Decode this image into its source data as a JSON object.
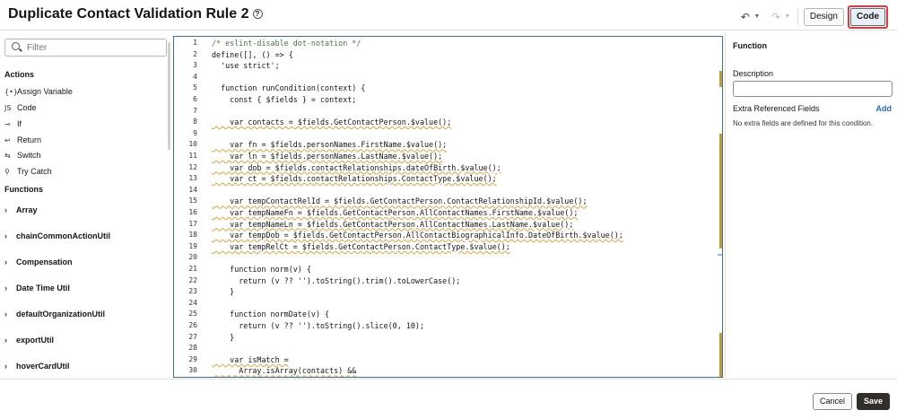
{
  "header": {
    "title": "Duplicate Contact Validation Rule 2",
    "help_glyph": "?",
    "undo_glyph": "↶",
    "redo_glyph": "↷",
    "design_label": "Design",
    "code_label": "Code"
  },
  "left": {
    "search_placeholder": "Filter",
    "actions_heading": "Actions",
    "actions": [
      {
        "icon": "{•}",
        "label": "Assign Variable"
      },
      {
        "icon": "JS",
        "label": "Code"
      },
      {
        "icon": "⊸",
        "label": "If"
      },
      {
        "icon": "↩",
        "label": "Return"
      },
      {
        "icon": "⇆",
        "label": "Switch"
      },
      {
        "icon": "⚲",
        "label": "Try Catch"
      }
    ],
    "functions_heading": "Functions",
    "functions": [
      "Array",
      "chainCommonActionUtil",
      "Compensation",
      "Date Time Util",
      "defaultOrganizationUtil",
      "exportUtil",
      "hoverCardUtil"
    ]
  },
  "editor": {
    "lines": [
      {
        "n": "1",
        "text": "/* eslint-disable dot-notation */"
      },
      {
        "n": "2",
        "text": "define([], () => {"
      },
      {
        "n": "3",
        "text": "  'use strict';"
      },
      {
        "n": "4",
        "text": ""
      },
      {
        "n": "5",
        "text": "  function runCondition(context) {"
      },
      {
        "n": "6",
        "text": "    const { $fields } = context;"
      },
      {
        "n": "7",
        "text": ""
      },
      {
        "n": "8",
        "text": "    var contacts = $fields.GetContactPerson.$value();"
      },
      {
        "n": "9",
        "text": ""
      },
      {
        "n": "10",
        "text": "    var fn = $fields.personNames.FirstName.$value();"
      },
      {
        "n": "11",
        "text": "    var ln = $fields.personNames.LastName.$value();"
      },
      {
        "n": "12",
        "text": "    var dob = $fields.contactRelationships.dateOfBirth.$value();"
      },
      {
        "n": "13",
        "text": "    var ct = $fields.contactRelationships.ContactType.$value();"
      },
      {
        "n": "14",
        "text": ""
      },
      {
        "n": "15",
        "text": "    var tempContactRelId = $fields.GetContactPerson.ContactRelationshipId.$value();"
      },
      {
        "n": "16",
        "text": "    var tempNameFn = $fields.GetContactPerson.AllContactNames.FirstName.$value();"
      },
      {
        "n": "17",
        "text": "    var tempNameLn = $fields.GetContactPerson.AllContactNames.LastName.$value();"
      },
      {
        "n": "18",
        "text": "    var tempDob = $fields.GetContactPerson.AllContactBiographicalInfo.DateOfBirth.$value();"
      },
      {
        "n": "19",
        "text": "    var tempRelCt = $fields.GetContactPerson.ContactType.$value();"
      },
      {
        "n": "20",
        "text": ""
      },
      {
        "n": "21",
        "text": "    function norm(v) {"
      },
      {
        "n": "22",
        "text": "      return (v ?? '').toString().trim().toLowerCase();"
      },
      {
        "n": "23",
        "text": "    }"
      },
      {
        "n": "24",
        "text": ""
      },
      {
        "n": "25",
        "text": "    function normDate(v) {"
      },
      {
        "n": "26",
        "text": "      return (v ?? '').toString().slice(0, 10);"
      },
      {
        "n": "27",
        "text": "    }"
      },
      {
        "n": "28",
        "text": ""
      },
      {
        "n": "29",
        "text": "    var isMatch ="
      },
      {
        "n": "30",
        "text": "      Array.isArray(contacts) &&"
      }
    ]
  },
  "right": {
    "function_label": "Function",
    "description_label": "Description",
    "extra_fields_label": "Extra Referenced Fields",
    "add_label": "Add",
    "no_fields_note": "No extra fields are defined for this condition."
  },
  "footer": {
    "cancel_label": "Cancel",
    "save_label": "Save"
  }
}
